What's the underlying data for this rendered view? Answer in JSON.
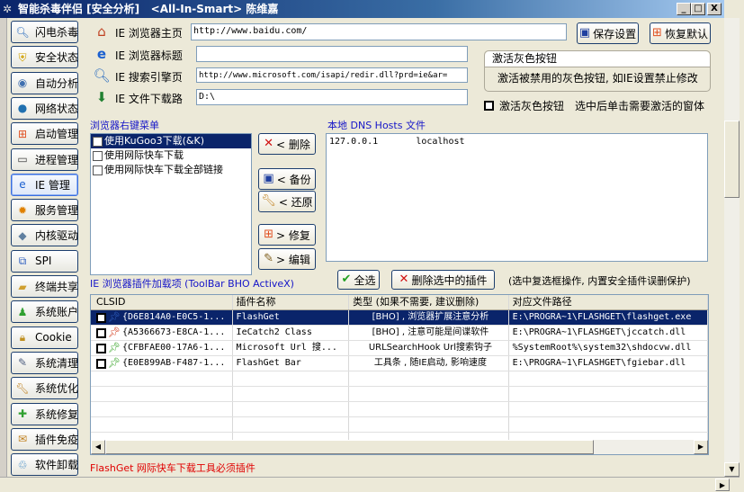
{
  "window": {
    "title": "智能杀毒伴侣 [安全分析]   <All-In-Smart> 陈维嘉",
    "min": "_",
    "max": "□",
    "close": "X"
  },
  "sidebar": {
    "items": [
      {
        "label": "闪电杀毒",
        "icon": "magnifier-icon"
      },
      {
        "label": "安全状态",
        "icon": "shield-icon"
      },
      {
        "label": "自动分析",
        "icon": "analysis-icon"
      },
      {
        "label": "网络状态",
        "icon": "globe-icon"
      },
      {
        "label": "启动管理",
        "icon": "windows-flag-icon"
      },
      {
        "label": "进程管理",
        "icon": "monitor-icon"
      },
      {
        "label": "IE 管理",
        "icon": "ie-icon",
        "active": true
      },
      {
        "label": "服务管理",
        "icon": "gear-icon"
      },
      {
        "label": "内核驱动",
        "icon": "chip-icon"
      },
      {
        "label": "SPI",
        "icon": "network-icon"
      },
      {
        "label": "终端共享",
        "icon": "folder-icon"
      },
      {
        "label": "系统账户",
        "icon": "user-icon"
      },
      {
        "label": "Cookie",
        "icon": "lock-icon"
      },
      {
        "label": "系统清理",
        "icon": "broom-icon"
      },
      {
        "label": "系统优化",
        "icon": "wrench-icon"
      },
      {
        "label": "系统修复",
        "icon": "repair-icon"
      },
      {
        "label": "插件免疫",
        "icon": "plugin-icon"
      },
      {
        "label": "软件卸载",
        "icon": "uninstall-icon"
      }
    ]
  },
  "ie_settings": {
    "home_label": "IE 浏览器主页",
    "home_value": "http://www.baidu.com/",
    "title_label": "IE 浏览器标题",
    "title_value": "",
    "search_label": "IE 搜索引擎页",
    "search_value": "http://www.microsoft.com/isapi/redir.dll?prd=ie&ar=",
    "download_label": "IE 文件下载路",
    "download_value": "D:\\"
  },
  "buttons": {
    "save": "保存设置",
    "restore_default": "恢复默认",
    "delete": "< 删除",
    "backup": "< 备份",
    "restore": "< 还原",
    "repair": "> 修复",
    "edit": "> 编辑",
    "select_all": "全选",
    "delete_selected": "删除选中的插件"
  },
  "activate_group": {
    "title": "激活灰色按钮",
    "desc": "激活被禁用的灰色按钮, 如IE设置禁止修改",
    "checkbox_label": "激活灰色按钮",
    "hint": "选中后单击需要激活的窗体"
  },
  "context_menu": {
    "label": "浏览器右键菜单",
    "items": [
      {
        "label": "使用KuGoo3下载(&K)",
        "selected": true
      },
      {
        "label": "使用网际快车下载"
      },
      {
        "label": "使用网际快车下载全部链接"
      }
    ]
  },
  "hosts": {
    "label": "本地 DNS Hosts 文件",
    "lines": [
      "127.0.0.1       localhost"
    ]
  },
  "plugins": {
    "label": "IE 浏览器插件加载项 (ToolBar BHO ActiveX)",
    "note": "(选中复选框操作, 内置安全插件误删保护)",
    "columns": [
      "CLSID",
      "插件名称",
      "类型 (如果不需要, 建议删除)",
      "对应文件路径"
    ],
    "rows": [
      {
        "clsid": "{D6E814A0-E0C5-1...",
        "name": "FlashGet",
        "type": "[BHO] , 浏览器扩展注意分析",
        "path": "E:\\PROGRA~1\\FLASHGET\\flashget.exe",
        "pin": "#3060c0",
        "selected": true
      },
      {
        "clsid": "{A5366673-E8CA-1...",
        "name": "IeCatch2 Class",
        "type": "[BHO] , 注意可能是间谍软件",
        "path": "E:\\PROGRA~1\\FLASHGET\\jccatch.dll",
        "pin": "#d03010"
      },
      {
        "clsid": "{CFBFAE00-17A6-1...",
        "name": "Microsoft Url 搜...",
        "type": "URLSearchHook Url搜索钩子",
        "path": "%SystemRoot%\\system32\\shdocvw.dll",
        "pin": "#30a020"
      },
      {
        "clsid": "{E0E899AB-F487-1...",
        "name": "FlashGet Bar",
        "type": "工具条 , 随IE启动, 影响速度",
        "path": "E:\\PROGRA~1\\FLASHGET\\fgiebar.dll",
        "pin": "#30a020"
      }
    ]
  },
  "status": {
    "text": "FlashGet 网际快车下载工具必须插件",
    "color": "#e00000"
  }
}
